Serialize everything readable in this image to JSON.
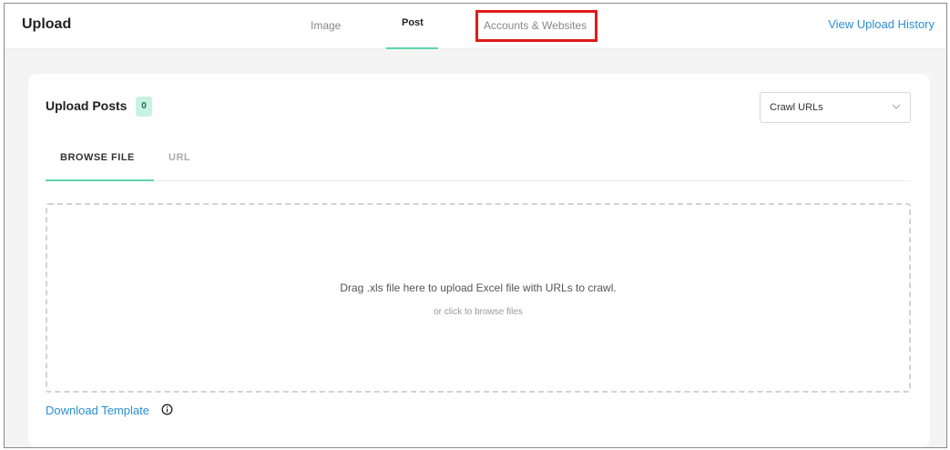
{
  "header": {
    "title": "Upload",
    "tabs": [
      {
        "label": "Image",
        "active": false
      },
      {
        "label": "Post",
        "active": true
      },
      {
        "label": "Accounts & Websites",
        "active": false
      }
    ],
    "history_link": "View Upload History"
  },
  "upload_card": {
    "title": "Upload Posts",
    "count": "0",
    "mode_select": {
      "value": "Crawl URLs",
      "icon": "chevron-down-icon"
    },
    "tabs": [
      {
        "label": "BROWSE FILE",
        "active": true
      },
      {
        "label": "URL",
        "active": false
      }
    ],
    "dropzone": {
      "main_text": "Drag .xls file here to upload Excel file with URLs to crawl.",
      "sub_text": "or click to browse files"
    },
    "template_link": "Download Template",
    "template_info_icon": "info-circle-icon"
  },
  "colors": {
    "accent": "#5ed6a8",
    "link": "#2a8fd6",
    "highlight": "#e01b1b",
    "badge_bg": "#c9f3e1"
  }
}
